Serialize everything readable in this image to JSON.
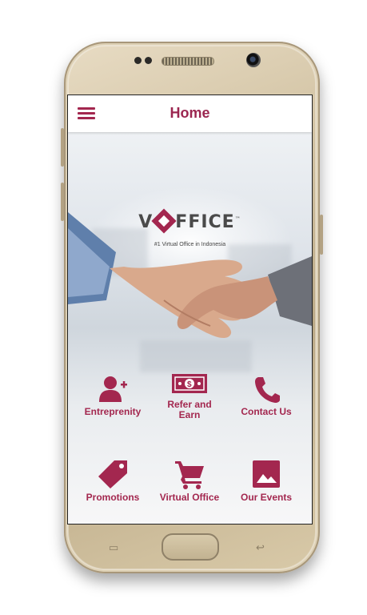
{
  "app": {
    "title": "Home",
    "logo": {
      "text_left": "V",
      "text_right": "FFICE",
      "mark": "™",
      "tagline": "#1 Virtual Office in Indonesia"
    },
    "accent_color": "#a3274f"
  },
  "menu": [
    {
      "label": "Entreprenity",
      "icon": "add-user-icon"
    },
    {
      "label": "Refer and Earn",
      "icon": "money-bill-icon"
    },
    {
      "label": "Contact Us",
      "icon": "phone-icon"
    },
    {
      "label": "Promotions",
      "icon": "tag-icon"
    },
    {
      "label": "Virtual Office",
      "icon": "cart-icon"
    },
    {
      "label": "Our Events",
      "icon": "image-icon"
    }
  ]
}
